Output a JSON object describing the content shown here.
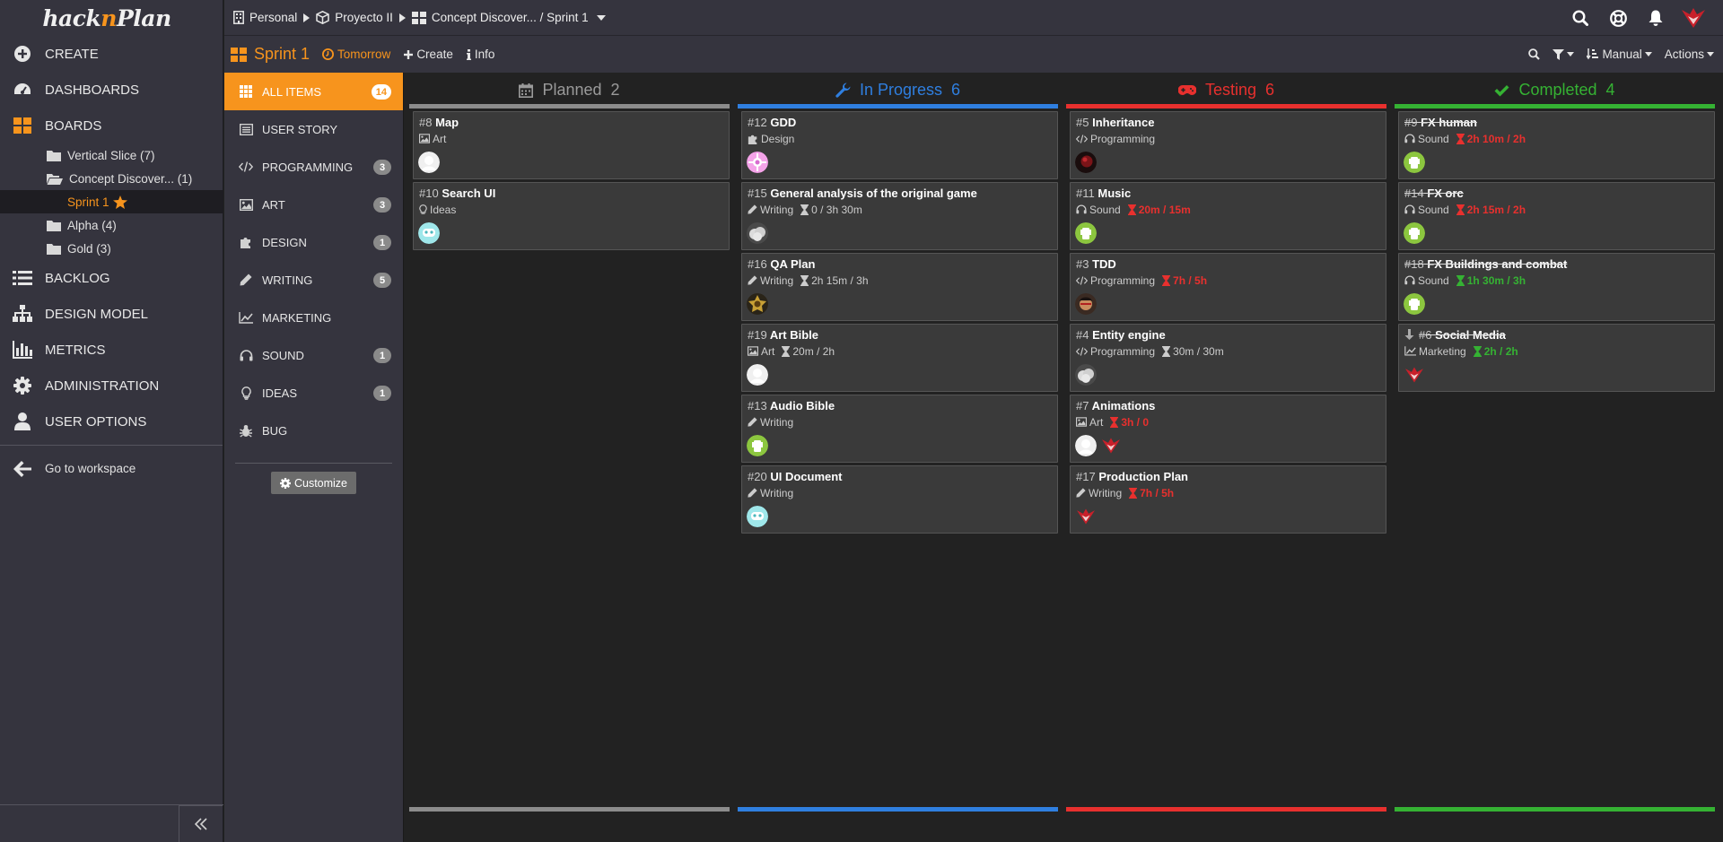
{
  "app": {
    "logo_left": "hack",
    "logo_mid": "n",
    "logo_right": "Plan"
  },
  "sidebar": {
    "nav_top": [
      {
        "label": "CREATE",
        "icon": "plus-circle-icon"
      },
      {
        "label": "DASHBOARDS",
        "icon": "dashboard-icon"
      },
      {
        "label": "BOARDS",
        "icon": "boards-icon"
      }
    ],
    "folders": [
      {
        "label": "Vertical Slice (7)"
      },
      {
        "label": "Concept Discover... (1)"
      },
      {
        "label": "Sprint 1"
      },
      {
        "label": "Alpha (4)"
      },
      {
        "label": "Gold (3)"
      }
    ],
    "nav_bottom": [
      {
        "label": "BACKLOG",
        "icon": "list-icon"
      },
      {
        "label": "DESIGN MODEL",
        "icon": "sitemap-icon"
      },
      {
        "label": "METRICS",
        "icon": "bar-chart-icon"
      },
      {
        "label": "ADMINISTRATION",
        "icon": "gear-icon"
      },
      {
        "label": "USER OPTIONS",
        "icon": "user-icon"
      }
    ],
    "go_workspace": "Go to workspace"
  },
  "breadcrumb": {
    "workspace": "Personal",
    "project": "Proyecto II",
    "board": "Concept Discover... / Sprint 1"
  },
  "sprint": {
    "name": "Sprint 1",
    "due": "Tomorrow",
    "create": "Create",
    "info": "Info",
    "sort": "Manual",
    "actions": "Actions"
  },
  "categories": [
    {
      "label": "ALL ITEMS",
      "count": "14"
    },
    {
      "label": "USER STORY",
      "count": ""
    },
    {
      "label": "PROGRAMMING",
      "count": "3"
    },
    {
      "label": "ART",
      "count": "3"
    },
    {
      "label": "DESIGN",
      "count": "1"
    },
    {
      "label": "WRITING",
      "count": "5"
    },
    {
      "label": "MARKETING",
      "count": ""
    },
    {
      "label": "SOUND",
      "count": "1"
    },
    {
      "label": "IDEAS",
      "count": "1"
    },
    {
      "label": "BUG",
      "count": ""
    }
  ],
  "customize": "Customize",
  "colors": {
    "accent": "#f7941d",
    "planned": "#8c8c8c",
    "in_progress": "#2f7fe0",
    "testing": "#e8302e",
    "completed": "#35b233"
  },
  "columns": [
    {
      "title": "Planned",
      "count": "2",
      "cards": [
        {
          "num": "#8",
          "title": "Map",
          "cat": "Art",
          "time": "",
          "tstate": "",
          "avatars": [
            "white"
          ]
        },
        {
          "num": "#10",
          "title": "Search UI",
          "cat": "Ideas",
          "time": "",
          "tstate": "",
          "avatars": [
            "cyan"
          ]
        }
      ]
    },
    {
      "title": "In Progress",
      "count": "6",
      "cards": [
        {
          "num": "#12",
          "title": "GDD",
          "cat": "Design",
          "time": "",
          "tstate": "",
          "avatars": [
            "pink"
          ]
        },
        {
          "num": "#15",
          "title": "General analysis of the original game",
          "cat": "Writing",
          "time": "0 / 3h 30m",
          "tstate": "grey",
          "avatars": [
            "cloud"
          ]
        },
        {
          "num": "#16",
          "title": "QA Plan",
          "cat": "Writing",
          "time": "2h 15m / 3h",
          "tstate": "grey",
          "avatars": [
            "badge"
          ]
        },
        {
          "num": "#19",
          "title": "Art Bible",
          "cat": "Art",
          "time": "20m / 2h",
          "tstate": "grey",
          "avatars": [
            "white"
          ]
        },
        {
          "num": "#13",
          "title": "Audio Bible",
          "cat": "Writing",
          "time": "",
          "tstate": "",
          "avatars": [
            "green"
          ]
        },
        {
          "num": "#20",
          "title": "UI Document",
          "cat": "Writing",
          "time": "",
          "tstate": "",
          "avatars": [
            "cyan"
          ]
        }
      ]
    },
    {
      "title": "Testing",
      "count": "6",
      "cards": [
        {
          "num": "#5",
          "title": "Inheritance",
          "cat": "Programming",
          "time": "",
          "tstate": "",
          "avatars": [
            "dark"
          ]
        },
        {
          "num": "#11",
          "title": "Music",
          "cat": "Sound",
          "time": "20m / 15m",
          "tstate": "red",
          "avatars": [
            "green"
          ]
        },
        {
          "num": "#3",
          "title": "TDD",
          "cat": "Programming",
          "time": "7h / 5h",
          "tstate": "red",
          "avatars": [
            "face"
          ]
        },
        {
          "num": "#4",
          "title": "Entity engine",
          "cat": "Programming",
          "time": "30m / 30m",
          "tstate": "grey",
          "avatars": [
            "cloud"
          ]
        },
        {
          "num": "#7",
          "title": "Animations",
          "cat": "Art",
          "time": "3h / 0",
          "tstate": "red",
          "avatars": [
            "white",
            "red"
          ]
        },
        {
          "num": "#17",
          "title": "Production Plan",
          "cat": "Writing",
          "time": "7h / 5h",
          "tstate": "red",
          "avatars": [
            "red"
          ]
        }
      ]
    },
    {
      "title": "Completed",
      "count": "4",
      "cards": [
        {
          "num": "#9",
          "title": "FX human",
          "cat": "Sound",
          "time": "2h 10m / 2h",
          "tstate": "red",
          "avatars": [
            "green"
          ],
          "done": true
        },
        {
          "num": "#14",
          "title": "FX orc",
          "cat": "Sound",
          "time": "2h 15m / 2h",
          "tstate": "red",
          "avatars": [
            "green"
          ],
          "done": true
        },
        {
          "num": "#18",
          "title": "FX Buildings and combat",
          "cat": "Sound",
          "time": "1h 30m / 3h",
          "tstate": "green",
          "avatars": [
            "green"
          ],
          "done": true
        },
        {
          "num": "#6",
          "title": "Social Media",
          "cat": "Marketing",
          "time": "2h / 2h",
          "tstate": "green",
          "avatars": [
            "red"
          ],
          "done": true,
          "arrow": true
        }
      ]
    }
  ]
}
